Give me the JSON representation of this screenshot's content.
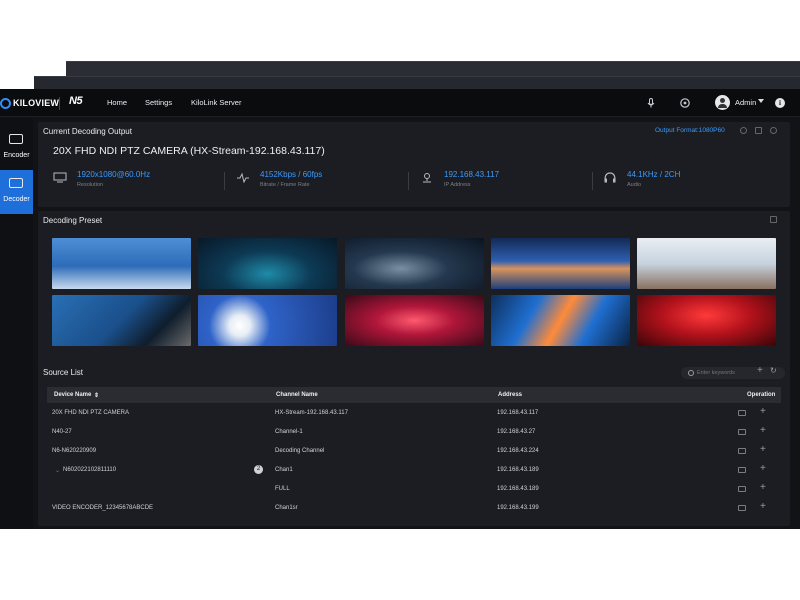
{
  "brand": {
    "logo": "KILOVIEW",
    "product": "N5"
  },
  "nav": [
    "Home",
    "Settings",
    "KiloLink Server"
  ],
  "user": {
    "name": "Admin"
  },
  "sidebar": [
    {
      "label": "Encoder",
      "icon": "encoder-icon"
    },
    {
      "label": "Decoder",
      "icon": "decoder-icon"
    }
  ],
  "output": {
    "heading": "Current Decoding Output",
    "format": "Output Format:1080P60",
    "camera": "20X FHD NDI PTZ CAMERA (HX-Stream-192.168.43.117)",
    "stats": [
      {
        "value": "1920x1080@60.0Hz",
        "label": "Resolution",
        "icon": "monitor-icon"
      },
      {
        "value": "4152Kbps / 60fps",
        "label": "Bitrate / Frame Rate",
        "icon": "pulse-icon"
      },
      {
        "value": "192.168.43.117",
        "label": "IP Address",
        "icon": "location-icon"
      },
      {
        "value": "44.1KHz / 2CH",
        "label": "Audio",
        "icon": "headphones-icon"
      }
    ]
  },
  "presets": {
    "heading": "Decoding Preset"
  },
  "source": {
    "heading": "Source List",
    "search_placeholder": "Enter keywords",
    "columns": [
      "Device Name",
      "Channel Name",
      "Address",
      "Operation"
    ],
    "rows": [
      {
        "device": "20X FHD NDI PTZ CAMERA",
        "channel": "HX-Stream-192.168.43.117",
        "address": "192.168.43.117"
      },
      {
        "device": "N40-27",
        "channel": "Channel-1",
        "address": "192.168.43.27"
      },
      {
        "device": "N6-N620220909",
        "channel": "Decoding Channel",
        "address": "192.168.43.224"
      },
      {
        "device": "N602022102811110",
        "channel": "Chan1",
        "address": "192.168.43.189",
        "badge": "2"
      },
      {
        "device": "",
        "channel": "FULL",
        "address": "192.168.43.189"
      },
      {
        "device": "VIDEO ENCODER_12345678ABCDE",
        "channel": "Chan1sr",
        "address": "192.168.43.199"
      }
    ]
  }
}
